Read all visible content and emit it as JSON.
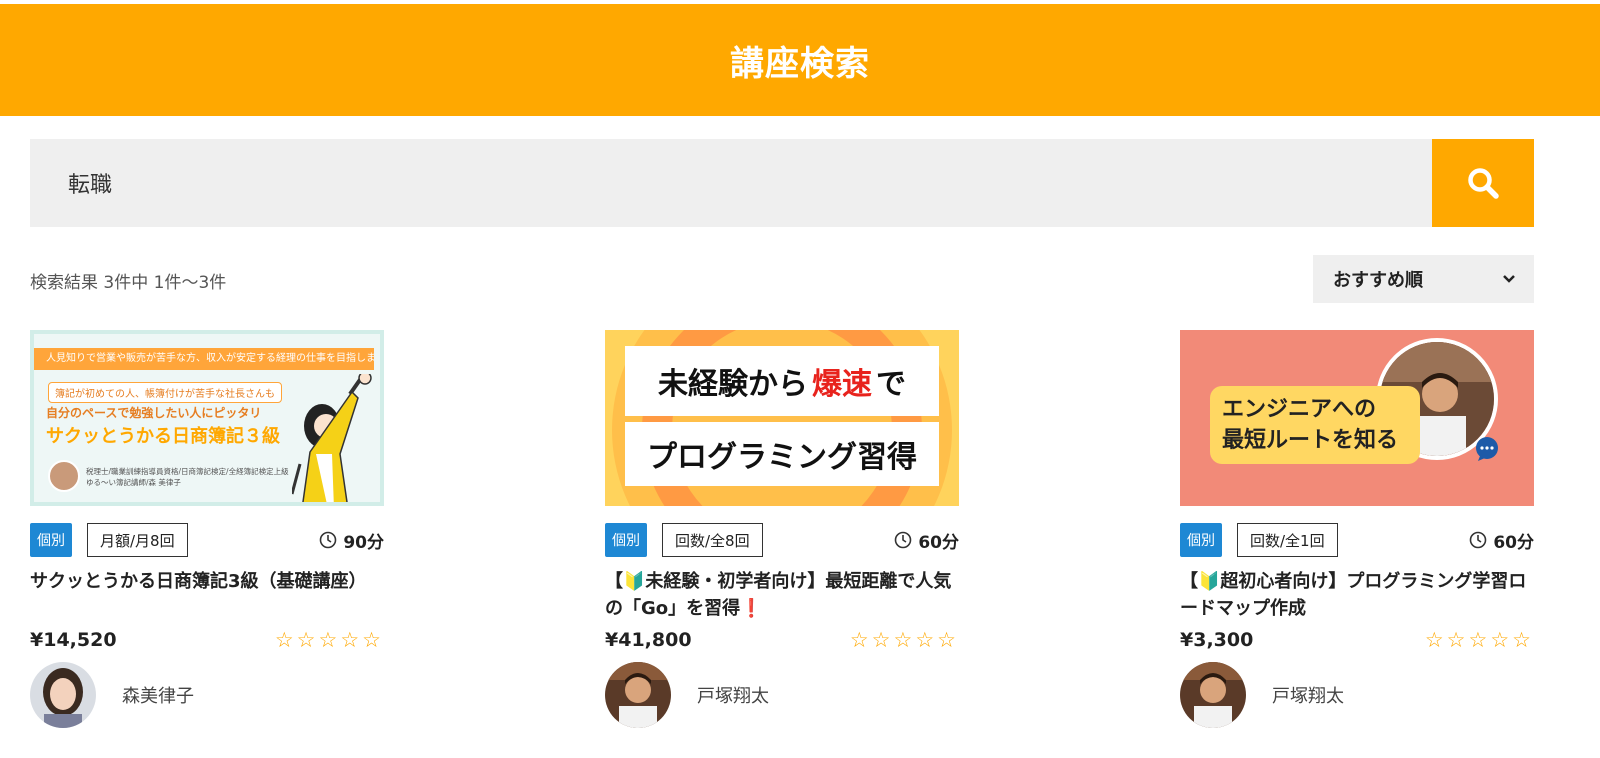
{
  "header": {
    "title": "講座検索"
  },
  "search": {
    "value": "転職",
    "button_icon": "search-icon"
  },
  "results": {
    "count_text": "検索結果 3件中 1件～3件",
    "sort": {
      "selected": "おすすめ順",
      "icon": "chevron-down-icon"
    }
  },
  "colors": {
    "accent": "#ffa800",
    "badge_blue": "#1e88d4",
    "star": "#ffa800"
  },
  "courses": [
    {
      "thumbnail": {
        "band": "人見知りで営業や販売が苦手な方、収入が安定する経理の仕事を目指しませんか？",
        "pill": "簿記が初めての人、帳簿付けが苦手な社長さんも",
        "line3": "自分のペースで勉強したい人にピッタリ",
        "line4": "サクッとうかる日商簿記３級",
        "small1": "税理士/職業訓練指導員資格/日商簿記検定/全経簿記検定上級",
        "small2": "ゆる～い簿記講師/森 美律子"
      },
      "type_badge": "個別",
      "plan_badge": "月額/月8回",
      "duration": "90分",
      "title": "サクッとうかる日商簿記3級（基礎講座）",
      "price": "¥14,520",
      "rating": 0,
      "stars": "☆☆☆☆☆",
      "instructor": "森美律子"
    },
    {
      "thumbnail": {
        "line1_a": "未経験から",
        "line1_red": "爆速",
        "line1_b": "で",
        "line2": "プログラミング習得"
      },
      "type_badge": "個別",
      "plan_badge": "回数/全8回",
      "duration": "60分",
      "title": "【🔰未経験・初学者向け】最短距離で人気の「Go」を習得❗",
      "price": "¥41,800",
      "rating": 0,
      "stars": "☆☆☆☆☆",
      "instructor": "戸塚翔太"
    },
    {
      "thumbnail": {
        "line1": "エンジニアへの",
        "line2": "最短ルートを知る"
      },
      "type_badge": "個別",
      "plan_badge": "回数/全1回",
      "duration": "60分",
      "title": "【🔰超初心者向け】プログラミング学習ロードマップ作成",
      "price": "¥3,300",
      "rating": 0,
      "stars": "☆☆☆☆☆",
      "instructor": "戸塚翔太"
    }
  ]
}
